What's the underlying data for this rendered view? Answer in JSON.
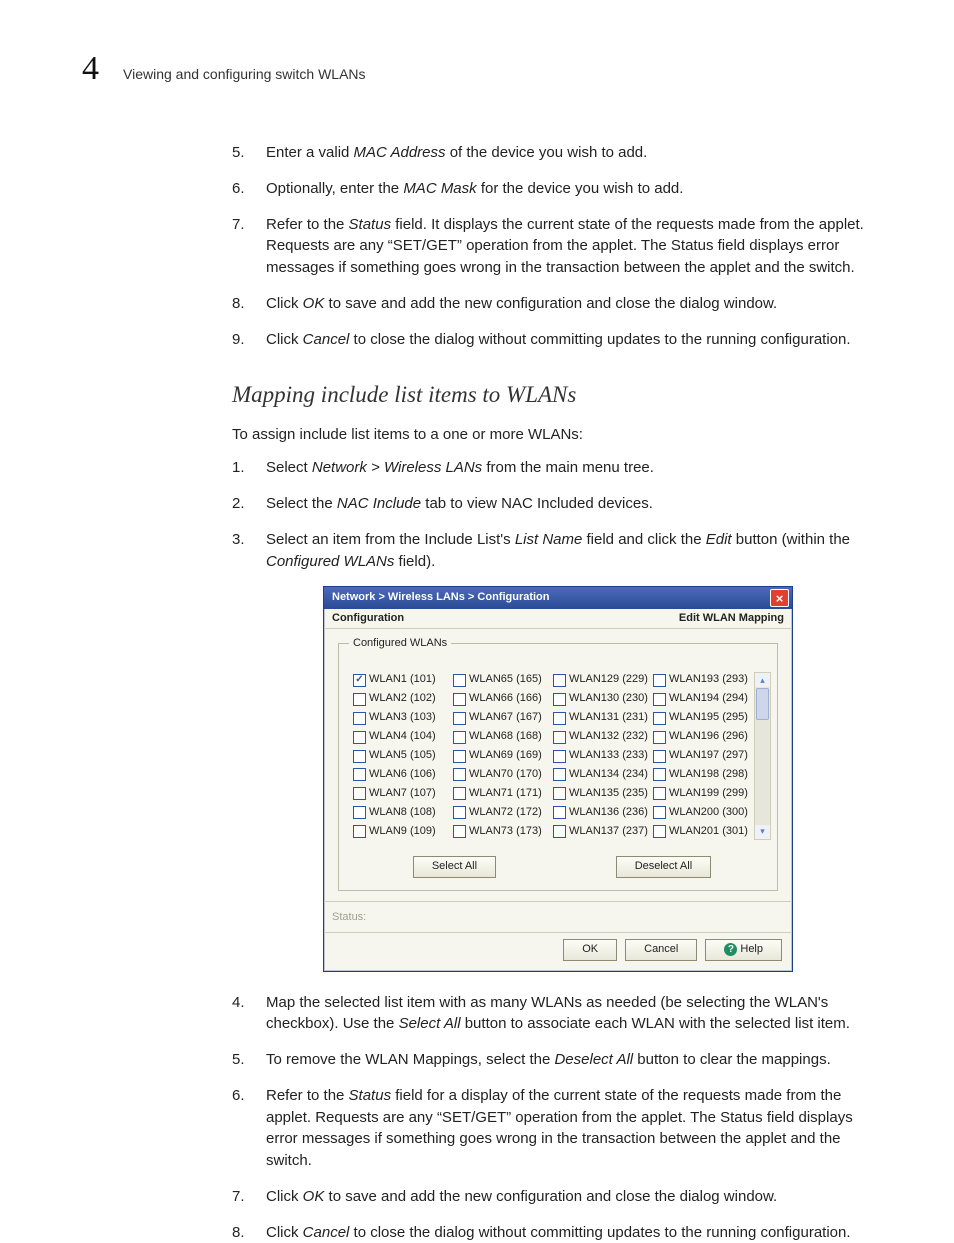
{
  "header": {
    "chapter_number": "4",
    "title": "Viewing and configuring switch WLANs"
  },
  "steps_top": [
    {
      "n": "5.",
      "pre": "Enter a valid ",
      "em": "MAC Address",
      "post": " of the device you wish to add."
    },
    {
      "n": "6.",
      "pre": "Optionally, enter the ",
      "em": "MAC Mask",
      "post": " for the device you wish to add."
    },
    {
      "n": "7.",
      "pre": "Refer to the ",
      "em": "Status",
      "post": " field. It displays the current state of the requests made from the applet. Requests are any “SET/GET” operation from the applet. The Status field displays error messages if something goes wrong in the transaction between the applet and the switch."
    },
    {
      "n": "8.",
      "pre": "Click ",
      "em": "OK",
      "post": " to save and add the new configuration and close the dialog window."
    },
    {
      "n": "9.",
      "pre": "Click ",
      "em": "Cancel",
      "post": " to close the dialog without committing updates to the running configuration."
    }
  ],
  "section_heading": "Mapping include list items to WLANs",
  "intro_line": "To assign include list items to a one or more WLANs:",
  "steps_mid": [
    {
      "n": "1.",
      "html": "Select <em class='ital'>Network &gt; Wireless LANs</em> from the main menu tree."
    },
    {
      "n": "2.",
      "html": "Select the <em class='ital'>NAC Include</em> tab to view NAC Included devices."
    },
    {
      "n": "3.",
      "html": "Select an item from the Include List's <em class='ital'>List Name</em> field and click the <em class='ital'>Edit</em> button (within the <em class='ital'>Configured WLANs</em> field)."
    }
  ],
  "dialog": {
    "breadcrumb": "Network > Wireless LANs > Configuration",
    "config_label": "Configuration",
    "edit_label": "Edit WLAN Mapping",
    "legend": "Configured WLANs",
    "columns": [
      [
        {
          "label": "WLAN1 (101)",
          "checked": true
        },
        {
          "label": "WLAN2 (102)"
        },
        {
          "label": "WLAN3 (103)"
        },
        {
          "label": "WLAN4 (104)"
        },
        {
          "label": "WLAN5 (105)"
        },
        {
          "label": "WLAN6 (106)"
        },
        {
          "label": "WLAN7 (107)"
        },
        {
          "label": "WLAN8 (108)"
        },
        {
          "label": "WLAN9 (109)"
        }
      ],
      [
        {
          "label": "WLAN65 (165)"
        },
        {
          "label": "WLAN66 (166)"
        },
        {
          "label": "WLAN67 (167)"
        },
        {
          "label": "WLAN68 (168)"
        },
        {
          "label": "WLAN69 (169)"
        },
        {
          "label": "WLAN70 (170)"
        },
        {
          "label": "WLAN71 (171)"
        },
        {
          "label": "WLAN72 (172)"
        },
        {
          "label": "WLAN73 (173)"
        }
      ],
      [
        {
          "label": "WLAN129 (229)"
        },
        {
          "label": "WLAN130 (230)"
        },
        {
          "label": "WLAN131 (231)"
        },
        {
          "label": "WLAN132 (232)"
        },
        {
          "label": "WLAN133 (233)"
        },
        {
          "label": "WLAN134 (234)"
        },
        {
          "label": "WLAN135 (235)"
        },
        {
          "label": "WLAN136 (236)"
        },
        {
          "label": "WLAN137 (237)"
        }
      ],
      [
        {
          "label": "WLAN193 (293)"
        },
        {
          "label": "WLAN194 (294)"
        },
        {
          "label": "WLAN195 (295)"
        },
        {
          "label": "WLAN196 (296)"
        },
        {
          "label": "WLAN197 (297)"
        },
        {
          "label": "WLAN198 (298)"
        },
        {
          "label": "WLAN199 (299)"
        },
        {
          "label": "WLAN200 (300)"
        },
        {
          "label": "WLAN201 (301)"
        }
      ]
    ],
    "select_all": "Select All",
    "deselect_all": "Deselect All",
    "status_label": "Status:",
    "ok": "OK",
    "cancel": "Cancel",
    "help": "Help"
  },
  "steps_bottom": [
    {
      "n": "4.",
      "html": "Map the selected list item with as many WLANs as needed (be selecting the WLAN's checkbox). Use the <em class='ital'>Select All</em> button to associate each WLAN with the selected list item."
    },
    {
      "n": "5.",
      "html": "To remove the WLAN Mappings, select the <em class='ital'>Deselect All</em> button to clear the mappings."
    },
    {
      "n": "6.",
      "html": "Refer to the <em class='ital'>Status</em> field for a display of the current state of the requests made from the applet. Requests are any “SET/GET” operation from the applet. The Status field displays error messages if something goes wrong in the transaction between the applet and the switch."
    },
    {
      "n": "7.",
      "html": "Click <em class='ital'>OK</em> to save and add the new configuration and close the dialog window."
    },
    {
      "n": "8.",
      "html": "Click <em class='ital'>Cancel</em> to close the dialog without committing updates to the running configuration."
    }
  ]
}
